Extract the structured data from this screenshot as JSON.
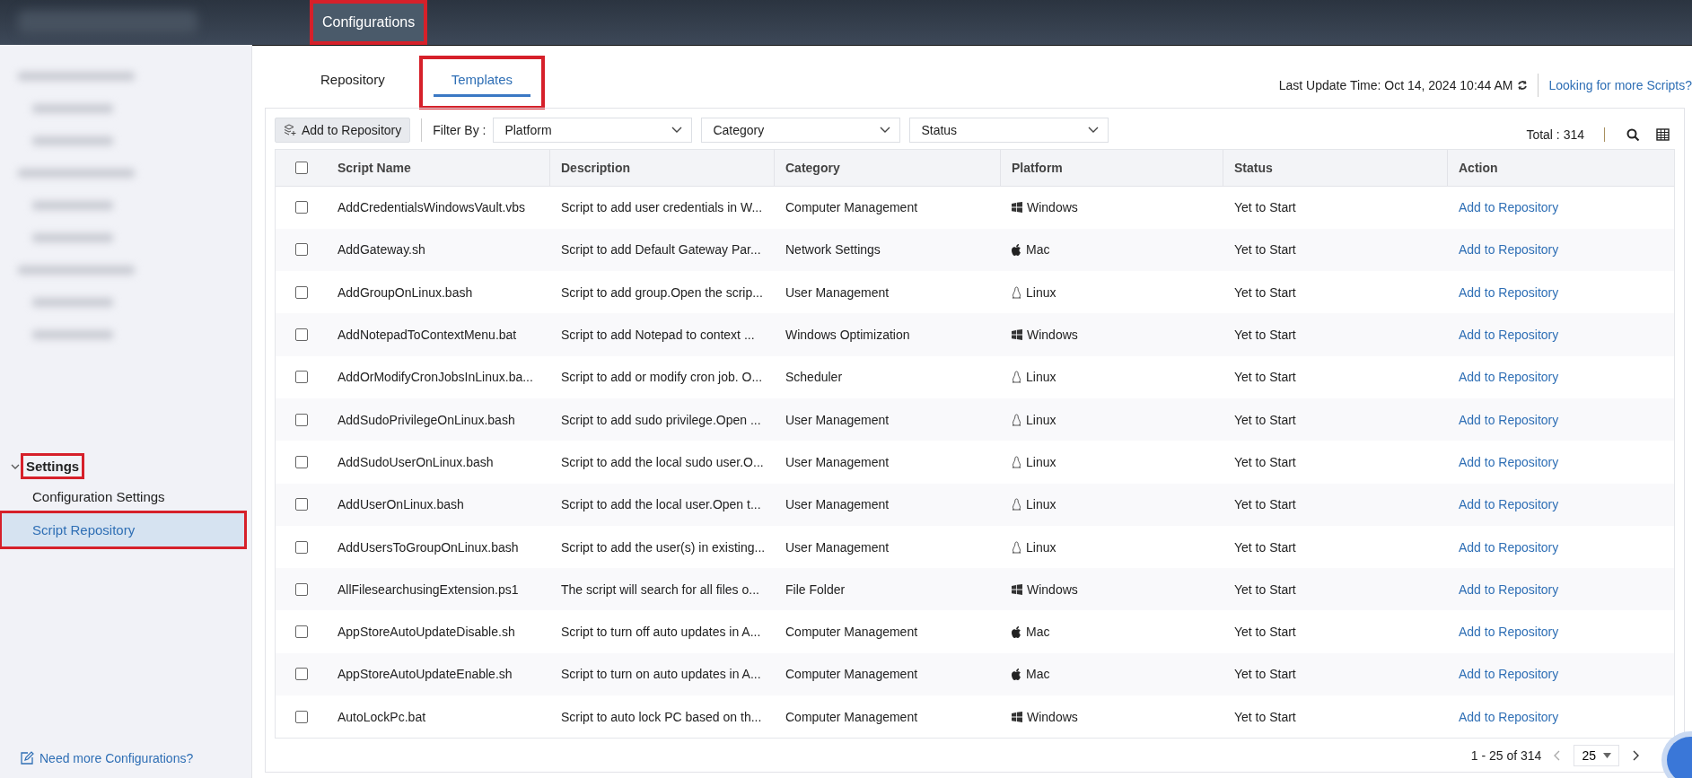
{
  "top_bar": {
    "tabs": [
      {
        "label": "Configurations",
        "selected": true,
        "highlighted": true
      }
    ]
  },
  "sidebar": {
    "section": {
      "label": "Settings",
      "expanded": true,
      "highlighted": true,
      "items": [
        {
          "label": "Configuration Settings",
          "selected": false,
          "highlighted": false
        },
        {
          "label": "Script Repository",
          "selected": true,
          "highlighted": true
        }
      ]
    },
    "footer_link": "Need more Configurations?"
  },
  "tabs": [
    {
      "label": "Repository",
      "selected": false,
      "highlighted": false
    },
    {
      "label": "Templates",
      "selected": true,
      "highlighted": true
    }
  ],
  "last_update": "Last Update Time: Oct 14, 2024 10:44 AM",
  "more_link": "Looking for more Scripts?",
  "toolbar": {
    "add_button": "Add to Repository",
    "filter_label": "Filter By :",
    "filters": [
      {
        "placeholder": "Platform"
      },
      {
        "placeholder": "Category"
      },
      {
        "placeholder": "Status"
      }
    ],
    "total": "Total : 314"
  },
  "table": {
    "select_all": {
      "checked": false
    },
    "columns": [
      "Script Name",
      "Description",
      "Category",
      "Platform",
      "Status",
      "Action"
    ],
    "rows": [
      {
        "kind": "windows",
        "checked": false,
        "name": "AddCredentialsWindowsVault.vbs",
        "description": "Script to add user credentials in W...",
        "category": "Computer Management",
        "platform": "Windows",
        "status": "Yet to Start",
        "action": "Add to Repository"
      },
      {
        "kind": "mac",
        "checked": false,
        "name": "AddGateway.sh",
        "description": "Script to add Default Gateway Par...",
        "category": "Network Settings",
        "platform": "Mac",
        "status": "Yet to Start",
        "action": "Add to Repository"
      },
      {
        "kind": "linux",
        "checked": false,
        "name": "AddGroupOnLinux.bash",
        "description": "Script to add group.Open the scrip...",
        "category": "User Management",
        "platform": "Linux",
        "status": "Yet to Start",
        "action": "Add to Repository"
      },
      {
        "kind": "windows",
        "checked": false,
        "name": "AddNotepadToContextMenu.bat",
        "description": "Script to add Notepad to context ...",
        "category": "Windows Optimization",
        "platform": "Windows",
        "status": "Yet to Start",
        "action": "Add to Repository"
      },
      {
        "kind": "linux",
        "checked": false,
        "name": "AddOrModifyCronJobsInLinux.ba...",
        "description": "Script to add or modify cron job. O...",
        "category": "Scheduler",
        "platform": "Linux",
        "status": "Yet to Start",
        "action": "Add to Repository"
      },
      {
        "kind": "linux",
        "checked": false,
        "name": "AddSudoPrivilegeOnLinux.bash",
        "description": "Script to add sudo privilege.Open ...",
        "category": "User Management",
        "platform": "Linux",
        "status": "Yet to Start",
        "action": "Add to Repository"
      },
      {
        "kind": "linux",
        "checked": false,
        "name": "AddSudoUserOnLinux.bash",
        "description": "Script to add the local sudo user.O...",
        "category": "User Management",
        "platform": "Linux",
        "status": "Yet to Start",
        "action": "Add to Repository"
      },
      {
        "kind": "linux",
        "checked": false,
        "name": "AddUserOnLinux.bash",
        "description": "Script to add the local user.Open t...",
        "category": "User Management",
        "platform": "Linux",
        "status": "Yet to Start",
        "action": "Add to Repository"
      },
      {
        "kind": "linux",
        "checked": false,
        "name": "AddUsersToGroupOnLinux.bash",
        "description": "Script to add the user(s) in existing...",
        "category": "User Management",
        "platform": "Linux",
        "status": "Yet to Start",
        "action": "Add to Repository"
      },
      {
        "kind": "windows",
        "checked": false,
        "name": "AllFilesearchusingExtension.ps1",
        "description": "The script will search for all files o...",
        "category": "File Folder",
        "platform": "Windows",
        "status": "Yet to Start",
        "action": "Add to Repository"
      },
      {
        "kind": "mac",
        "checked": false,
        "name": "AppStoreAutoUpdateDisable.sh",
        "description": "Script to turn off auto updates in A...",
        "category": "Computer Management",
        "platform": "Mac",
        "status": "Yet to Start",
        "action": "Add to Repository"
      },
      {
        "kind": "mac",
        "checked": false,
        "name": "AppStoreAutoUpdateEnable.sh",
        "description": "Script to turn on auto updates in A...",
        "category": "Computer Management",
        "platform": "Mac",
        "status": "Yet to Start",
        "action": "Add to Repository"
      },
      {
        "kind": "windows",
        "checked": false,
        "name": "AutoLockPc.bat",
        "description": "Script to auto lock PC based on th...",
        "category": "Computer Management",
        "platform": "Windows",
        "status": "Yet to Start",
        "action": "Add to Repository"
      }
    ]
  },
  "pagination": {
    "range": "1 - 25 of 314",
    "page_size": "25"
  }
}
